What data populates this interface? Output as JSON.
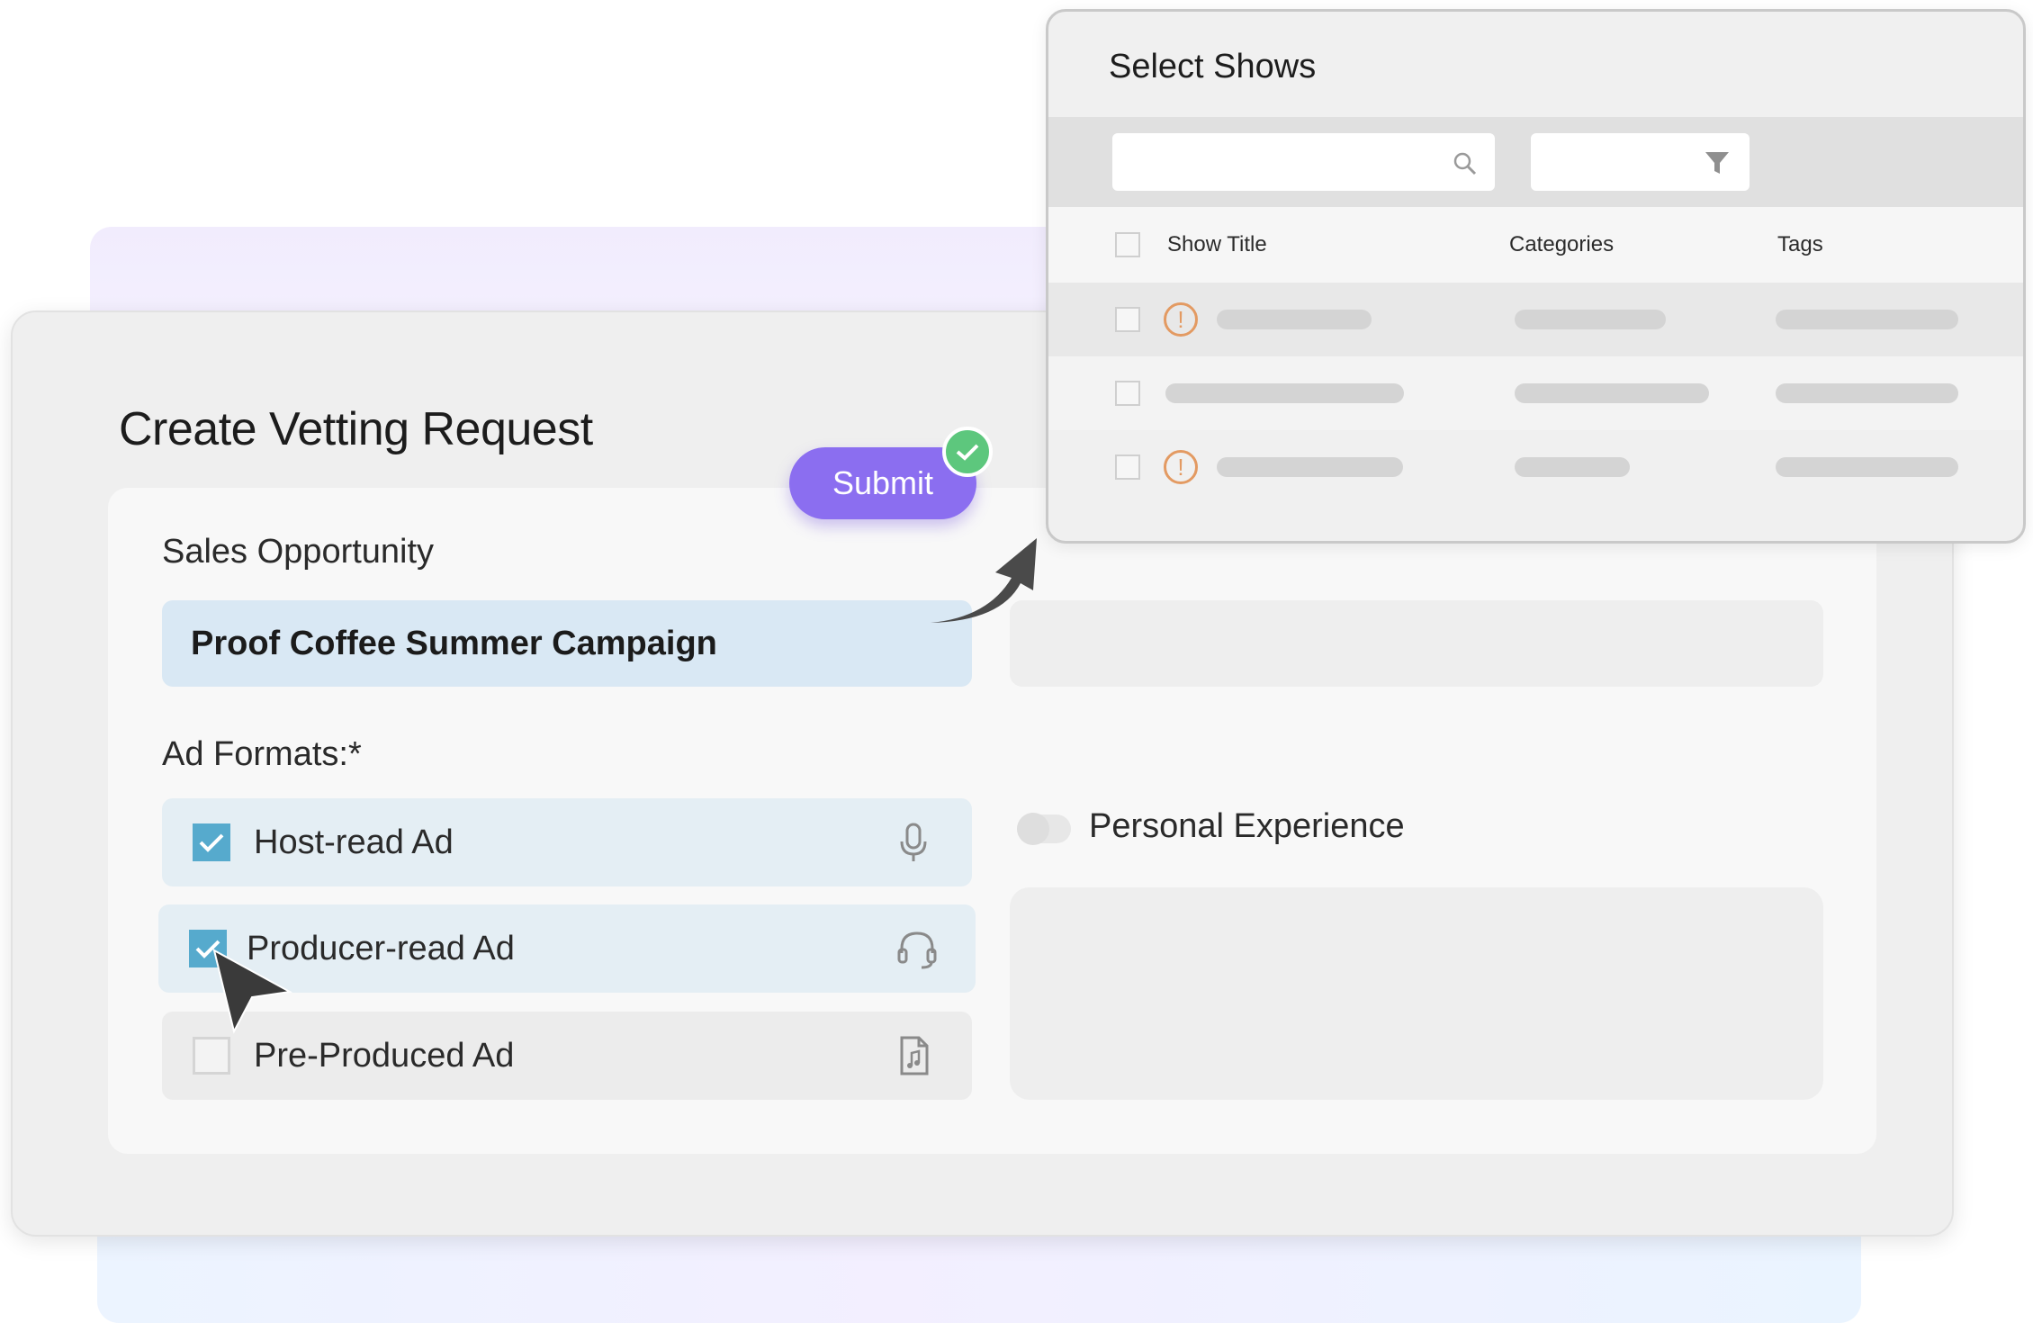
{
  "page": {
    "title": "Create Vetting Request",
    "sales_opportunity_label": "Sales Opportunity",
    "sales_opportunity_value": "Proof Coffee Summer Campaign",
    "ad_formats_label": "Ad Formats:*",
    "ad_formats": [
      {
        "label": "Host-read Ad",
        "checked": true,
        "icon": "microphone-icon"
      },
      {
        "label": "Producer-read Ad",
        "checked": true,
        "icon": "headset-icon"
      },
      {
        "label": "Pre-Produced Ad",
        "checked": false,
        "icon": "audio-file-icon"
      }
    ],
    "personal_experience_label": "Personal Experience",
    "personal_experience_on": false,
    "submit_label": "Submit"
  },
  "select_shows": {
    "title": "Select Shows",
    "search_icon": "search-icon",
    "filter_icon": "filter-icon",
    "columns": [
      "Show Title",
      "Categories",
      "Tags"
    ],
    "rows": [
      {
        "warning": true
      },
      {
        "warning": false
      },
      {
        "warning": true
      }
    ]
  },
  "colors": {
    "accent_purple": "#8b6ef0",
    "success_green": "#5dc77d",
    "checkbox_blue": "#56aacd",
    "warning_orange": "#e39a62"
  }
}
